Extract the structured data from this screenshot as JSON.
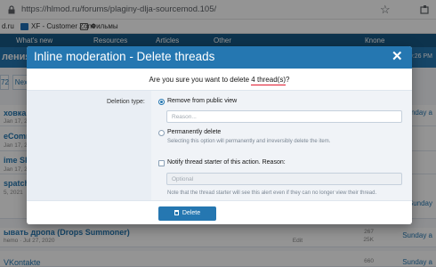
{
  "browser": {
    "url": "https://hlmod.ru/forums/plaginy-dlja-sourcemod.105/",
    "bookmarks": [
      "d.ru",
      "XF - Customer Zone",
      "Фильмы"
    ]
  },
  "site": {
    "nav": [
      "What's new",
      "Resources",
      "Articles",
      "Other",
      "Кnone"
    ],
    "forum_title": "ления",
    "time_text": "First 9:26 PM",
    "pages": [
      "72",
      "Next"
    ],
    "threads": [
      {
        "title": "ховка и к",
        "meta": "Jan 17, 2021",
        "right": "Sunday a",
        "right_small": ""
      },
      {
        "title": "eComms",
        "meta": "Jan 17, 2021",
        "right": "",
        "right_small": ""
      },
      {
        "title": "ime Sky",
        "meta": "Jan 17, 2021",
        "right": "",
        "right_small": ""
      },
      {
        "title": "spatchA",
        "meta": "5, 2021",
        "right": "Sunday",
        "right_small": ""
      },
      {
        "title": "ывать дропа (Drops Summoner)",
        "meta": "hemo · Jul 27, 2020",
        "right": "Sunday a",
        "right_small": "Edit",
        "replies": "267",
        "views": "25K"
      },
      {
        "title": "VKontakte",
        "meta": "",
        "right": "Sunday a",
        "right_small": "",
        "replies": "660",
        "views": ""
      }
    ]
  },
  "modal": {
    "title": "Inline moderation - Delete threads",
    "close_icon": "close-icon",
    "confirm_prefix": "Are you sure you want to delete",
    "confirm_count": "4 thread(s)",
    "confirm_suffix": "?",
    "deletion_type_label": "Deletion type:",
    "remove_label": "Remove from public view",
    "reason_placeholder": "Reason...",
    "permanent_label": "Permanently delete",
    "permanent_hint": "Selecting this option will permanently and irreversibly delete the item.",
    "notify_label": "Notify thread starter of this action. Reason:",
    "notify_placeholder": "Optional",
    "notify_hint": "Note that the thread starter will see this alert even if they can no longer view their thread.",
    "delete_button": "Delete",
    "selected_option": "remove"
  },
  "colors": {
    "accent": "#2577b1",
    "header_dark": "#185886",
    "underline": "#e0192e"
  }
}
